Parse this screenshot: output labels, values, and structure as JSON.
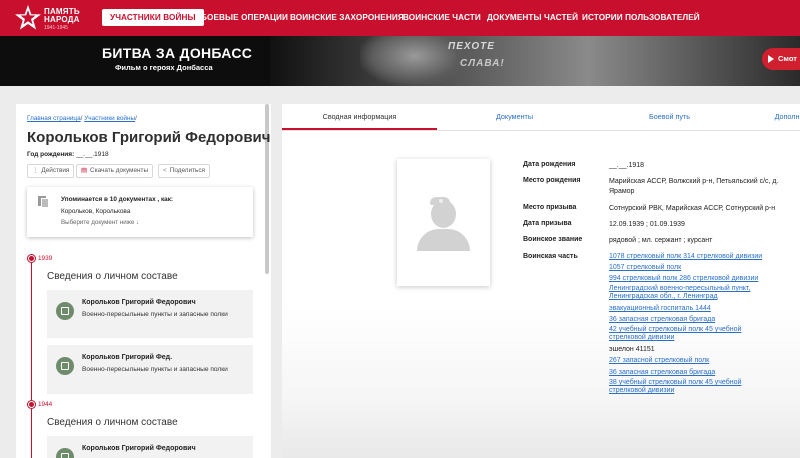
{
  "logo": {
    "line1": "ПАМЯТЬ",
    "line2": "НАРОДА",
    "years": "1941-1945"
  },
  "nav": {
    "items": [
      "УЧАСТНИКИ ВОЙНЫ",
      "БОЕВЫЕ ОПЕРАЦИИ",
      "ВОИНСКИЕ ЗАХОРОНЕНИЯ",
      "ВОИНСКИЕ ЧАСТИ",
      "ДОКУМЕНТЫ ЧАСТЕЙ",
      "ИСТОРИИ ПОЛЬЗОВАТЕЛЕЙ"
    ],
    "active": "УЧАСТНИКИ ВОЙНЫ"
  },
  "banner": {
    "title": "БИТВА ЗА ДОНБАСС",
    "subtitle": "Фильм о героях Донбасса",
    "engraving1": "ПЕХОТЕ",
    "engraving2": "СЛАВА!",
    "button": "Смот"
  },
  "breadcrumb": {
    "home": "Главная страница",
    "section": "Участники войны"
  },
  "person": {
    "name": "Корольков Григорий Федорович",
    "birth_label": "Год рождения:",
    "birth_value": "__.__.1918"
  },
  "actions": {
    "actions": "Действия",
    "download": "Скачать документы",
    "share": "Поделиться"
  },
  "mentions": {
    "title": "Упоминается в 10 документах , как:",
    "names": "Корольков, Королькова",
    "hint": "Выберите документ ниже ↓"
  },
  "timeline": [
    {
      "year": "1939",
      "heading": "Сведения о личном составе",
      "cards": [
        {
          "name": "Корольков Григорий Федорович",
          "desc": "Военно-пересыльные пункты и запасные полки"
        },
        {
          "name": "Корольков Григорий Фед.",
          "desc": "Военно-пересыльные пункты и запасные полки"
        }
      ]
    },
    {
      "year": "1944",
      "heading": "Сведения о личном составе",
      "cards": [
        {
          "name": "Корольков Григорий Федорович",
          "desc": ""
        }
      ]
    }
  ],
  "tabs": [
    "Сводная информация",
    "Документы",
    "Боевой путь",
    "Дополн"
  ],
  "active_tab": "Сводная информация",
  "profile": {
    "birth_date": {
      "label": "Дата рождения",
      "value": "__.__.1918"
    },
    "birth_place": {
      "label": "Место рождения",
      "value": "Марийская АССР, Волжский р-н, Петьяльский с/с, д. Ярамор"
    },
    "draft_place": {
      "label": "Место призыва",
      "value": "Сотнурский РВК, Марийская АССР, Сотнурский р-н"
    },
    "draft_date": {
      "label": "Дата призыва",
      "value": "12.09.1939 ; 01.09.1939"
    },
    "rank": {
      "label": "Воинское звание",
      "value": "рядовой ; мл. сержант ; курсант"
    },
    "unit": {
      "label": "Воинская часть",
      "items": [
        {
          "text": "1078 стрелковый полк 314 стрелковой дивизии",
          "link": true
        },
        {
          "text": "1057 стрелковый полк",
          "link": true
        },
        {
          "text": "994 стрелковый полк 286 стрелковой дивизии",
          "link": true
        },
        {
          "text": "Ленинградский военно-пересыльный пункт, Ленинградская обл., г. Ленинград",
          "link": true
        },
        {
          "text": "эвакуационный госпиталь 1444",
          "link": true
        },
        {
          "text": "36 запасная стрелковая бригада",
          "link": true
        },
        {
          "text": "42 учебный стрелковый полк 45 учебной стрелковой дивизии",
          "link": true
        },
        {
          "text": "эшелон 41151",
          "link": false
        },
        {
          "text": "267 запасной стрелковый полк",
          "link": true
        },
        {
          "text": "36 запасная стрелковая бригада",
          "link": true
        },
        {
          "text": "38 учебный стрелковый полк 45 учебной стрелковой дивизии",
          "link": true
        }
      ]
    }
  },
  "colors": {
    "brand_red": "#c8102e",
    "link_blue": "#2a6fc9",
    "badge_green": "#6e8c6b"
  }
}
